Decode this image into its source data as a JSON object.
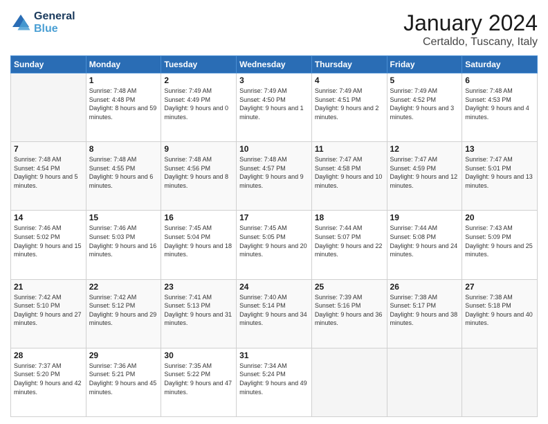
{
  "logo": {
    "line1": "General",
    "line2": "Blue"
  },
  "title": "January 2024",
  "subtitle": "Certaldo, Tuscany, Italy",
  "days_header": [
    "Sunday",
    "Monday",
    "Tuesday",
    "Wednesday",
    "Thursday",
    "Friday",
    "Saturday"
  ],
  "weeks": [
    [
      {
        "day": "",
        "info": ""
      },
      {
        "day": "1",
        "info": "Sunrise: 7:48 AM\nSunset: 4:48 PM\nDaylight: 8 hours\nand 59 minutes."
      },
      {
        "day": "2",
        "info": "Sunrise: 7:49 AM\nSunset: 4:49 PM\nDaylight: 9 hours\nand 0 minutes."
      },
      {
        "day": "3",
        "info": "Sunrise: 7:49 AM\nSunset: 4:50 PM\nDaylight: 9 hours\nand 1 minute."
      },
      {
        "day": "4",
        "info": "Sunrise: 7:49 AM\nSunset: 4:51 PM\nDaylight: 9 hours\nand 2 minutes."
      },
      {
        "day": "5",
        "info": "Sunrise: 7:49 AM\nSunset: 4:52 PM\nDaylight: 9 hours\nand 3 minutes."
      },
      {
        "day": "6",
        "info": "Sunrise: 7:48 AM\nSunset: 4:53 PM\nDaylight: 9 hours\nand 4 minutes."
      }
    ],
    [
      {
        "day": "7",
        "info": "Sunrise: 7:48 AM\nSunset: 4:54 PM\nDaylight: 9 hours\nand 5 minutes."
      },
      {
        "day": "8",
        "info": "Sunrise: 7:48 AM\nSunset: 4:55 PM\nDaylight: 9 hours\nand 6 minutes."
      },
      {
        "day": "9",
        "info": "Sunrise: 7:48 AM\nSunset: 4:56 PM\nDaylight: 9 hours\nand 8 minutes."
      },
      {
        "day": "10",
        "info": "Sunrise: 7:48 AM\nSunset: 4:57 PM\nDaylight: 9 hours\nand 9 minutes."
      },
      {
        "day": "11",
        "info": "Sunrise: 7:47 AM\nSunset: 4:58 PM\nDaylight: 9 hours\nand 10 minutes."
      },
      {
        "day": "12",
        "info": "Sunrise: 7:47 AM\nSunset: 4:59 PM\nDaylight: 9 hours\nand 12 minutes."
      },
      {
        "day": "13",
        "info": "Sunrise: 7:47 AM\nSunset: 5:01 PM\nDaylight: 9 hours\nand 13 minutes."
      }
    ],
    [
      {
        "day": "14",
        "info": "Sunrise: 7:46 AM\nSunset: 5:02 PM\nDaylight: 9 hours\nand 15 minutes."
      },
      {
        "day": "15",
        "info": "Sunrise: 7:46 AM\nSunset: 5:03 PM\nDaylight: 9 hours\nand 16 minutes."
      },
      {
        "day": "16",
        "info": "Sunrise: 7:45 AM\nSunset: 5:04 PM\nDaylight: 9 hours\nand 18 minutes."
      },
      {
        "day": "17",
        "info": "Sunrise: 7:45 AM\nSunset: 5:05 PM\nDaylight: 9 hours\nand 20 minutes."
      },
      {
        "day": "18",
        "info": "Sunrise: 7:44 AM\nSunset: 5:07 PM\nDaylight: 9 hours\nand 22 minutes."
      },
      {
        "day": "19",
        "info": "Sunrise: 7:44 AM\nSunset: 5:08 PM\nDaylight: 9 hours\nand 24 minutes."
      },
      {
        "day": "20",
        "info": "Sunrise: 7:43 AM\nSunset: 5:09 PM\nDaylight: 9 hours\nand 25 minutes."
      }
    ],
    [
      {
        "day": "21",
        "info": "Sunrise: 7:42 AM\nSunset: 5:10 PM\nDaylight: 9 hours\nand 27 minutes."
      },
      {
        "day": "22",
        "info": "Sunrise: 7:42 AM\nSunset: 5:12 PM\nDaylight: 9 hours\nand 29 minutes."
      },
      {
        "day": "23",
        "info": "Sunrise: 7:41 AM\nSunset: 5:13 PM\nDaylight: 9 hours\nand 31 minutes."
      },
      {
        "day": "24",
        "info": "Sunrise: 7:40 AM\nSunset: 5:14 PM\nDaylight: 9 hours\nand 34 minutes."
      },
      {
        "day": "25",
        "info": "Sunrise: 7:39 AM\nSunset: 5:16 PM\nDaylight: 9 hours\nand 36 minutes."
      },
      {
        "day": "26",
        "info": "Sunrise: 7:38 AM\nSunset: 5:17 PM\nDaylight: 9 hours\nand 38 minutes."
      },
      {
        "day": "27",
        "info": "Sunrise: 7:38 AM\nSunset: 5:18 PM\nDaylight: 9 hours\nand 40 minutes."
      }
    ],
    [
      {
        "day": "28",
        "info": "Sunrise: 7:37 AM\nSunset: 5:20 PM\nDaylight: 9 hours\nand 42 minutes."
      },
      {
        "day": "29",
        "info": "Sunrise: 7:36 AM\nSunset: 5:21 PM\nDaylight: 9 hours\nand 45 minutes."
      },
      {
        "day": "30",
        "info": "Sunrise: 7:35 AM\nSunset: 5:22 PM\nDaylight: 9 hours\nand 47 minutes."
      },
      {
        "day": "31",
        "info": "Sunrise: 7:34 AM\nSunset: 5:24 PM\nDaylight: 9 hours\nand 49 minutes."
      },
      {
        "day": "",
        "info": ""
      },
      {
        "day": "",
        "info": ""
      },
      {
        "day": "",
        "info": ""
      }
    ]
  ],
  "colors": {
    "header_bg": "#2a6db5",
    "header_text": "#ffffff",
    "accent": "#4a9fd4"
  }
}
